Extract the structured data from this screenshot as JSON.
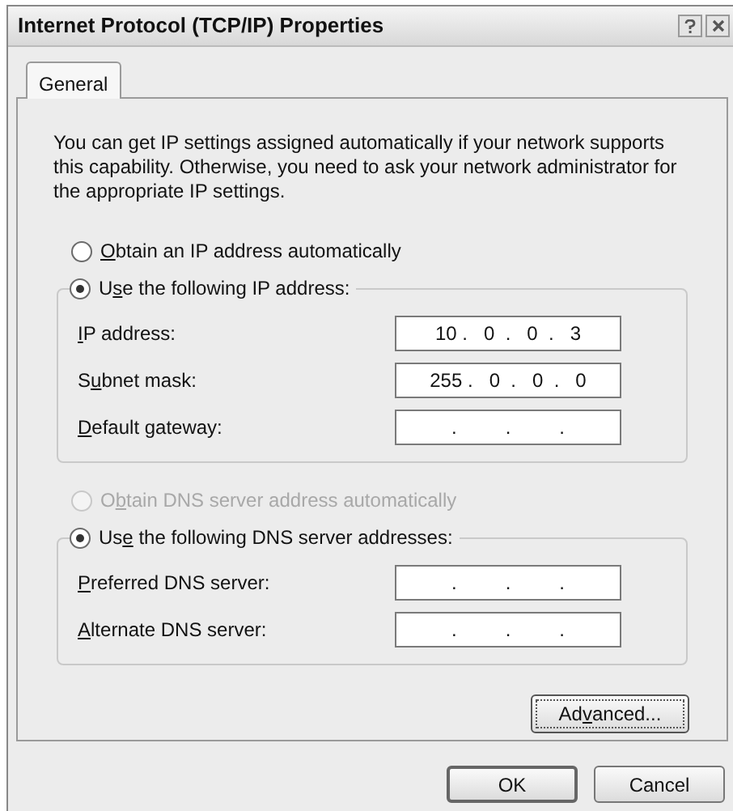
{
  "window": {
    "title": "Internet Protocol (TCP/IP) Properties"
  },
  "tabs": [
    {
      "label": "General",
      "selected": true
    }
  ],
  "intro": "You can get IP settings assigned automatically if your network supports this capability. Otherwise, you need to ask your network administrator for the appropriate IP settings.",
  "ip_section": {
    "auto_option": {
      "label": {
        "key": "O",
        "after": "btain an IP address automatically"
      },
      "selected": false,
      "disabled": false
    },
    "manual_option": {
      "label": {
        "before": "U",
        "key": "s",
        "after": "e the following IP address:"
      },
      "selected": true,
      "disabled": false
    },
    "fields": [
      {
        "label": {
          "key": "I",
          "after": "P address:"
        },
        "value": "10 .   0  .   0  .   3"
      },
      {
        "label": {
          "before": "S",
          "key": "u",
          "after": "bnet mask:"
        },
        "value": "255 .   0  .   0  .   0"
      },
      {
        "label": {
          "key": "D",
          "after": "efault gateway:"
        },
        "value": ".         .         ."
      }
    ]
  },
  "dns_section": {
    "auto_option": {
      "label": {
        "before": "O",
        "key": "b",
        "after": "tain DNS server address automatically"
      },
      "selected": false,
      "disabled": true
    },
    "manual_option": {
      "label": {
        "before": "Us",
        "key": "e",
        "after": " the following DNS server addresses:"
      },
      "selected": true,
      "disabled": false
    },
    "fields": [
      {
        "label": {
          "key": "P",
          "after": "referred DNS server:"
        },
        "value": ".         .         ."
      },
      {
        "label": {
          "key": "A",
          "after": "lternate DNS server:"
        },
        "value": ".         .         ."
      }
    ]
  },
  "advanced_button": {
    "label": {
      "before": "Ad",
      "key": "v",
      "after": "anced..."
    }
  },
  "buttons": [
    {
      "label": "OK",
      "kind": "default"
    },
    {
      "label": "Cancel",
      "kind": "normal"
    }
  ]
}
